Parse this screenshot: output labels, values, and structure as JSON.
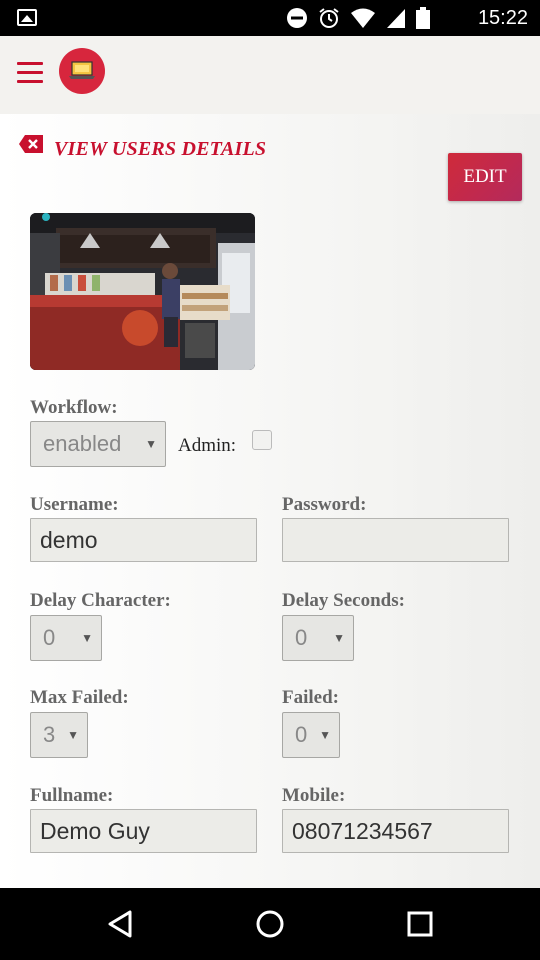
{
  "status_bar": {
    "time": "15:22",
    "icons": [
      "gallery-icon",
      "dnd-icon",
      "alarm-icon",
      "wifi-icon",
      "signal-icon",
      "battery-icon"
    ]
  },
  "app_bar": {
    "menu_icon": "hamburger-icon",
    "logo_icon": "laptop-logo-icon",
    "accent_color": "#c8102e"
  },
  "page": {
    "title": "VIEW USERS DETAILS",
    "edit_label": "EDIT"
  },
  "form": {
    "workflow": {
      "label": "Workflow:",
      "value": "enabled"
    },
    "admin": {
      "label": "Admin:",
      "checked": false
    },
    "username": {
      "label": "Username:",
      "value": "demo"
    },
    "password": {
      "label": "Password:",
      "value": ""
    },
    "delay_character": {
      "label": "Delay Character:",
      "value": "0"
    },
    "delay_seconds": {
      "label": "Delay Seconds:",
      "value": "0"
    },
    "max_failed": {
      "label": "Max Failed:",
      "value": "3"
    },
    "failed": {
      "label": "Failed:",
      "value": "0"
    },
    "fullname": {
      "label": "Fullname:",
      "value": "Demo Guy"
    },
    "mobile": {
      "label": "Mobile:",
      "value": "08071234567"
    }
  },
  "nav_bar": {
    "icons": [
      "back-icon",
      "home-icon",
      "recents-icon"
    ]
  }
}
